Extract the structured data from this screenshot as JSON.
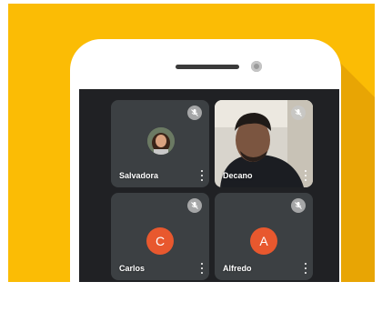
{
  "participants": [
    {
      "name": "Salvadora",
      "avatar": "photo",
      "muted": true
    },
    {
      "name": "Decano",
      "avatar": "video",
      "muted": true
    },
    {
      "name": "Carlos",
      "avatar_letter": "C",
      "muted": true
    },
    {
      "name": "Alfredo",
      "avatar_letter": "A",
      "muted": true
    }
  ],
  "colors": {
    "background": "#fbbc05",
    "screen": "#202124",
    "tile": "#3c4043",
    "avatar_accent": "#e8582e"
  },
  "icons": {
    "mute": "mic-off-icon",
    "more": "more-vert-icon"
  }
}
